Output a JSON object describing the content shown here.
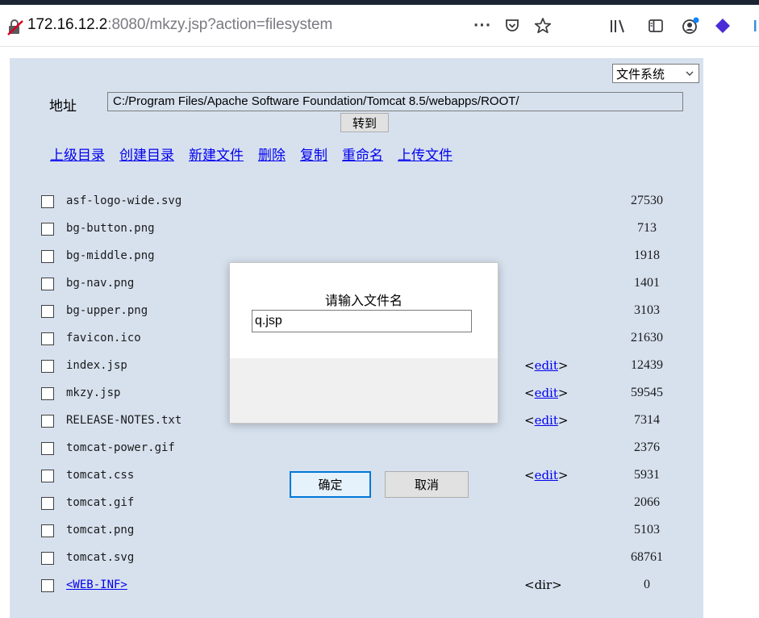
{
  "browser": {
    "url_host": "172.16.12.2",
    "url_rest": ":8080/mkzy.jsp?action=filesystem",
    "icons": [
      "insecure-connection-icon",
      "page-actions-icon",
      "pocket-icon",
      "bookmark-star-icon",
      "library-icon",
      "sidebar-icon",
      "account-icon",
      "extension-icon"
    ]
  },
  "page": {
    "mode_select": "文件系统",
    "address_label": "地址",
    "address_value": "C:/Program Files/Apache Software Foundation/Tomcat 8.5/webapps/ROOT/",
    "goto_label": "转到",
    "actions": [
      "上级目录",
      "创建目录",
      "新建文件",
      "删除",
      "复制",
      "重命名",
      "上传文件"
    ],
    "files": [
      {
        "name": "asf-logo-wide.svg",
        "edit": "",
        "size": "27530"
      },
      {
        "name": "bg-button.png",
        "edit": "",
        "size": "713"
      },
      {
        "name": "bg-middle.png",
        "edit": "",
        "size": "1918"
      },
      {
        "name": "bg-nav.png",
        "edit": "",
        "size": "1401"
      },
      {
        "name": "bg-upper.png",
        "edit": "",
        "size": "3103"
      },
      {
        "name": "favicon.ico",
        "edit": "",
        "size": "21630"
      },
      {
        "name": "index.jsp",
        "edit": "edit",
        "size": "12439"
      },
      {
        "name": "mkzy.jsp",
        "edit": "edit",
        "size": "59545"
      },
      {
        "name": "RELEASE-NOTES.txt",
        "edit": "edit",
        "size": "7314"
      },
      {
        "name": "tomcat-power.gif",
        "edit": "",
        "size": "2376"
      },
      {
        "name": "tomcat.css",
        "edit": "edit",
        "size": "5931"
      },
      {
        "name": "tomcat.gif",
        "edit": "",
        "size": "2066"
      },
      {
        "name": "tomcat.png",
        "edit": "",
        "size": "5103"
      },
      {
        "name": "tomcat.svg",
        "edit": "",
        "size": "68761"
      },
      {
        "name": "<WEB-INF>",
        "edit": "<dir>",
        "size": "0",
        "is_dir": true
      }
    ]
  },
  "dialog": {
    "title": "请输入文件名",
    "input_value": "q.jsp",
    "ok_label": "确定",
    "cancel_label": "取消"
  },
  "colors": {
    "panel_bg": "#d7e1ee",
    "link": "#0000ee",
    "ok_border": "#0078d7"
  }
}
